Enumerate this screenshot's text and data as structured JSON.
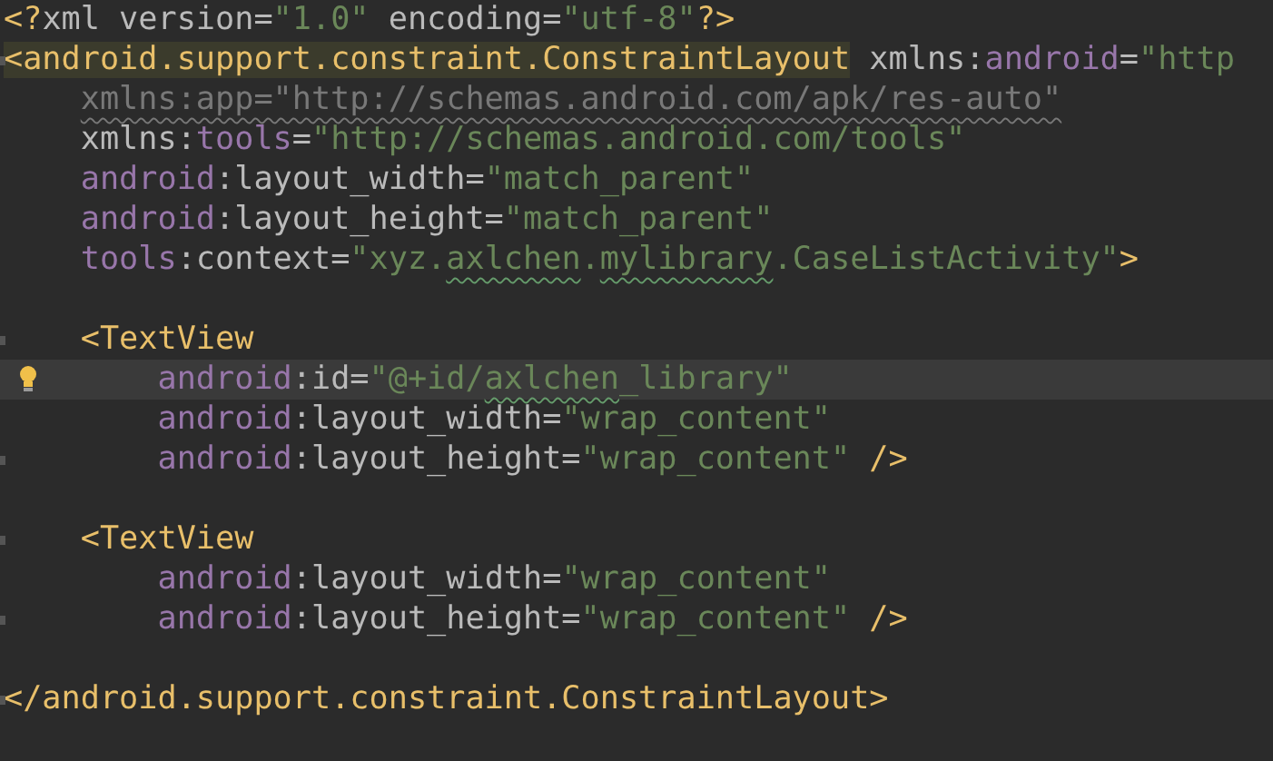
{
  "editor": {
    "lines": [
      {
        "kind": "code",
        "current": false,
        "bulb": false,
        "fold": false,
        "tokens": [
          {
            "kind": "tag",
            "text": "<?"
          },
          {
            "kind": "attr",
            "text": "xml version="
          },
          {
            "kind": "string",
            "text": "\"1.0\""
          },
          {
            "kind": "attr",
            "text": " encoding="
          },
          {
            "kind": "string",
            "text": "\"utf-8\""
          },
          {
            "kind": "tag",
            "text": "?>"
          }
        ]
      },
      {
        "kind": "code",
        "current": false,
        "bulb": false,
        "fold": true,
        "tokens": [
          {
            "kind": "tag_match",
            "text": "<android.support.constraint.ConstraintLayout"
          },
          {
            "kind": "attr",
            "text": " xmlns:"
          },
          {
            "kind": "ns",
            "text": "android"
          },
          {
            "kind": "attr",
            "text": "="
          },
          {
            "kind": "string",
            "text": "\"http"
          }
        ]
      },
      {
        "kind": "code",
        "current": false,
        "bulb": false,
        "fold": false,
        "tokens": [
          {
            "kind": "unused",
            "text": "    xmlns:app=\"http://schemas.android.com/apk/res-auto\""
          }
        ]
      },
      {
        "kind": "code",
        "current": false,
        "bulb": false,
        "fold": false,
        "tokens": [
          {
            "kind": "attr",
            "text": "    xmlns:"
          },
          {
            "kind": "ns",
            "text": "tools"
          },
          {
            "kind": "attr",
            "text": "="
          },
          {
            "kind": "string",
            "text": "\"http://schemas.android.com/tools\""
          }
        ]
      },
      {
        "kind": "code",
        "current": false,
        "bulb": false,
        "fold": false,
        "tokens": [
          {
            "kind": "ns",
            "text": "    android"
          },
          {
            "kind": "attr",
            "text": ":layout_width="
          },
          {
            "kind": "string",
            "text": "\"match_parent\""
          }
        ]
      },
      {
        "kind": "code",
        "current": false,
        "bulb": false,
        "fold": false,
        "tokens": [
          {
            "kind": "ns",
            "text": "    android"
          },
          {
            "kind": "attr",
            "text": ":layout_height="
          },
          {
            "kind": "string",
            "text": "\"match_parent\""
          }
        ]
      },
      {
        "kind": "code",
        "current": false,
        "bulb": false,
        "fold": false,
        "tokens": [
          {
            "kind": "ns",
            "text": "    tools"
          },
          {
            "kind": "attr",
            "text": ":context="
          },
          {
            "kind": "string",
            "text": "\"xyz."
          },
          {
            "kind": "string_typo",
            "text": "axlchen"
          },
          {
            "kind": "string",
            "text": "."
          },
          {
            "kind": "string_typo",
            "text": "mylibrary"
          },
          {
            "kind": "string",
            "text": ".CaseListActivity\""
          },
          {
            "kind": "tag",
            "text": ">"
          }
        ]
      },
      {
        "kind": "blank"
      },
      {
        "kind": "code",
        "current": false,
        "bulb": false,
        "fold": true,
        "tokens": [
          {
            "kind": "tag",
            "text": "    <TextView"
          }
        ]
      },
      {
        "kind": "code",
        "current": true,
        "bulb": true,
        "fold": false,
        "tokens": [
          {
            "kind": "ns",
            "text": "        android"
          },
          {
            "kind": "attr",
            "text": ":id="
          },
          {
            "kind": "string",
            "text": "\"@+id/"
          },
          {
            "kind": "string_typo",
            "text": "axlchen"
          },
          {
            "kind": "string",
            "text": "_library\""
          }
        ]
      },
      {
        "kind": "code",
        "current": false,
        "bulb": false,
        "fold": false,
        "tokens": [
          {
            "kind": "ns",
            "text": "        android"
          },
          {
            "kind": "attr",
            "text": ":layout_width="
          },
          {
            "kind": "string",
            "text": "\"wrap_content\""
          }
        ]
      },
      {
        "kind": "code",
        "current": false,
        "bulb": false,
        "fold": true,
        "tokens": [
          {
            "kind": "ns",
            "text": "        android"
          },
          {
            "kind": "attr",
            "text": ":layout_height="
          },
          {
            "kind": "string",
            "text": "\"wrap_content\""
          },
          {
            "kind": "tag",
            "text": " />"
          }
        ]
      },
      {
        "kind": "blank"
      },
      {
        "kind": "code",
        "current": false,
        "bulb": false,
        "fold": true,
        "tokens": [
          {
            "kind": "tag",
            "text": "    <TextView"
          }
        ]
      },
      {
        "kind": "code",
        "current": false,
        "bulb": false,
        "fold": false,
        "tokens": [
          {
            "kind": "ns",
            "text": "        android"
          },
          {
            "kind": "attr",
            "text": ":layout_width="
          },
          {
            "kind": "string",
            "text": "\"wrap_content\""
          }
        ]
      },
      {
        "kind": "code",
        "current": false,
        "bulb": false,
        "fold": true,
        "tokens": [
          {
            "kind": "ns",
            "text": "        android"
          },
          {
            "kind": "attr",
            "text": ":layout_height="
          },
          {
            "kind": "string",
            "text": "\"wrap_content\""
          },
          {
            "kind": "tag",
            "text": " />"
          }
        ]
      },
      {
        "kind": "blank"
      },
      {
        "kind": "code",
        "current": false,
        "bulb": false,
        "fold": true,
        "tokens": [
          {
            "kind": "tag",
            "text": "</android.support.constraint.ConstraintLayout>"
          }
        ]
      }
    ]
  }
}
